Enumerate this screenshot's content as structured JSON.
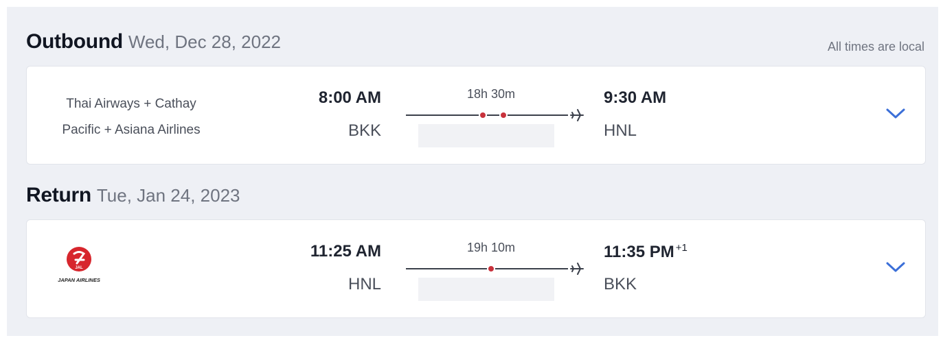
{
  "note": "All times are local",
  "outbound": {
    "title": "Outbound",
    "date": "Wed, Dec 28, 2022",
    "airline_line1": "Thai Airways + Cathay",
    "airline_line2": "Pacific + Asiana Airlines",
    "dep_time": "8:00 AM",
    "dep_code": "BKK",
    "duration": "18h 30m",
    "stops": 2,
    "arr_time": "9:30 AM",
    "arr_code": "HNL",
    "expand_icon": "chevron-down-icon"
  },
  "return": {
    "title": "Return",
    "date": "Tue, Jan 24, 2023",
    "airline_logo_text": "JAPAN AIRLINES",
    "airline_logo_mark": "JAL",
    "dep_time": "11:25 AM",
    "dep_code": "HNL",
    "duration": "19h 10m",
    "stops": 1,
    "arr_time": "11:35 PM",
    "arr_day_offset": "+1",
    "arr_code": "BKK",
    "expand_icon": "chevron-down-icon"
  },
  "colors": {
    "accent": "#3b6fd8",
    "stop_dot": "#c8323c",
    "route_line": "#3a3f4a",
    "panel_bg": "#eef0f5",
    "jal_red": "#d7262d"
  }
}
